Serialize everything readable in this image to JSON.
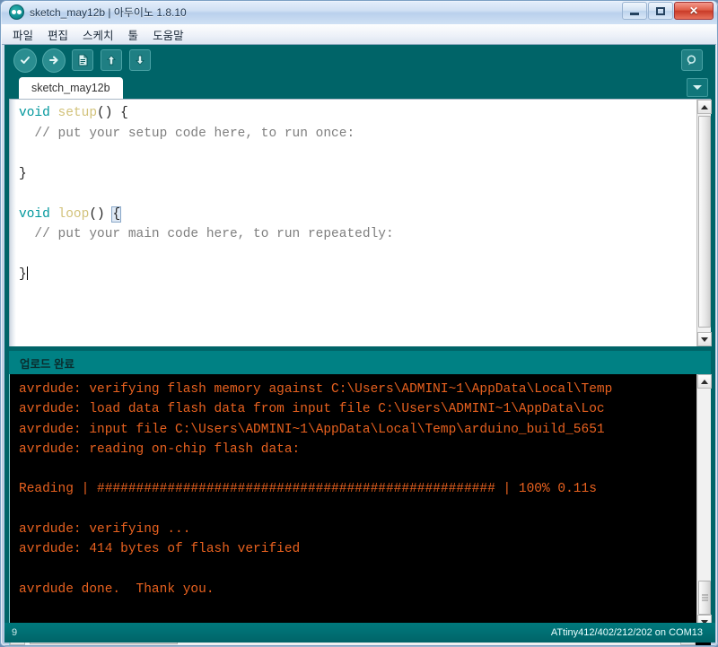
{
  "window": {
    "title": "sketch_may12b | 아두이노 1.8.10",
    "logo_icon": "arduino-logo-icon",
    "minimize_label": "Minimize",
    "maximize_label": "Maximize",
    "close_label": "✕",
    "frame_color": "#b4c8e0",
    "accent_teal": "#006468"
  },
  "menubar": {
    "items": [
      {
        "label": "파일"
      },
      {
        "label": "편집"
      },
      {
        "label": "스케치"
      },
      {
        "label": "툴"
      },
      {
        "label": "도움말"
      }
    ]
  },
  "toolbar": {
    "buttons": [
      {
        "name": "verify-button",
        "icon": "check-icon",
        "tooltip": "확인"
      },
      {
        "name": "upload-button",
        "icon": "arrow-right-icon",
        "tooltip": "업로드"
      },
      {
        "name": "new-button",
        "icon": "new-file-icon",
        "tooltip": "새 파일"
      },
      {
        "name": "open-button",
        "icon": "arrow-up-icon",
        "tooltip": "열기"
      },
      {
        "name": "save-button",
        "icon": "arrow-down-icon",
        "tooltip": "저장"
      }
    ],
    "serial_monitor": {
      "name": "serial-monitor-button",
      "icon": "serial-monitor-icon",
      "tooltip": "시리얼 모니터"
    }
  },
  "tabs": {
    "active": "sketch_may12b",
    "items": [
      {
        "label": "sketch_may12b"
      }
    ],
    "menu_icon": "chevron-down-icon"
  },
  "editor": {
    "lines": [
      {
        "segments": [
          {
            "t": "void",
            "c": "kw"
          },
          {
            "t": " ",
            "c": ""
          },
          {
            "t": "setup",
            "c": "fn"
          },
          {
            "t": "() {",
            "c": ""
          }
        ]
      },
      {
        "segments": [
          {
            "t": "  // put your setup code here, to run once:",
            "c": "cm"
          }
        ]
      },
      {
        "segments": [
          {
            "t": "",
            "c": ""
          }
        ]
      },
      {
        "segments": [
          {
            "t": "}",
            "c": ""
          }
        ]
      },
      {
        "segments": [
          {
            "t": "",
            "c": ""
          }
        ]
      },
      {
        "segments": [
          {
            "t": "void",
            "c": "kw"
          },
          {
            "t": " ",
            "c": ""
          },
          {
            "t": "loop",
            "c": "fn"
          },
          {
            "t": "() ",
            "c": ""
          },
          {
            "t": "{",
            "c": "brace-hl"
          }
        ]
      },
      {
        "segments": [
          {
            "t": "  // put your main code here, to run repeatedly:",
            "c": "cm"
          }
        ]
      },
      {
        "segments": [
          {
            "t": "",
            "c": ""
          }
        ]
      },
      {
        "segments": [
          {
            "t": "}",
            "c": ""
          },
          {
            "t": "|caret|",
            "c": "caret"
          }
        ]
      }
    ],
    "keyword_color": "#00979c",
    "function_color": "#d2c27a",
    "comment_color": "#7e7e7e"
  },
  "status_message": {
    "text": "업로드 완료",
    "background": "#008184"
  },
  "console": {
    "text_color": "#e8611f",
    "background": "#000000",
    "lines": [
      "avrdude: verifying flash memory against C:\\Users\\ADMINI~1\\AppData\\Local\\Temp",
      "avrdude: load data flash data from input file C:\\Users\\ADMINI~1\\AppData\\Loc",
      "avrdude: input file C:\\Users\\ADMINI~1\\AppData\\Local\\Temp\\arduino_build_5651",
      "avrdude: reading on-chip flash data:",
      "",
      "Reading | ################################################### | 100% 0.11s",
      "",
      "avrdude: verifying ...",
      "avrdude: 414 bytes of flash verified",
      "",
      "avrdude done.  Thank you."
    ]
  },
  "bottom_bar": {
    "line_number": "9",
    "board_info": "ATtiny412/402/212/202 on COM13"
  }
}
